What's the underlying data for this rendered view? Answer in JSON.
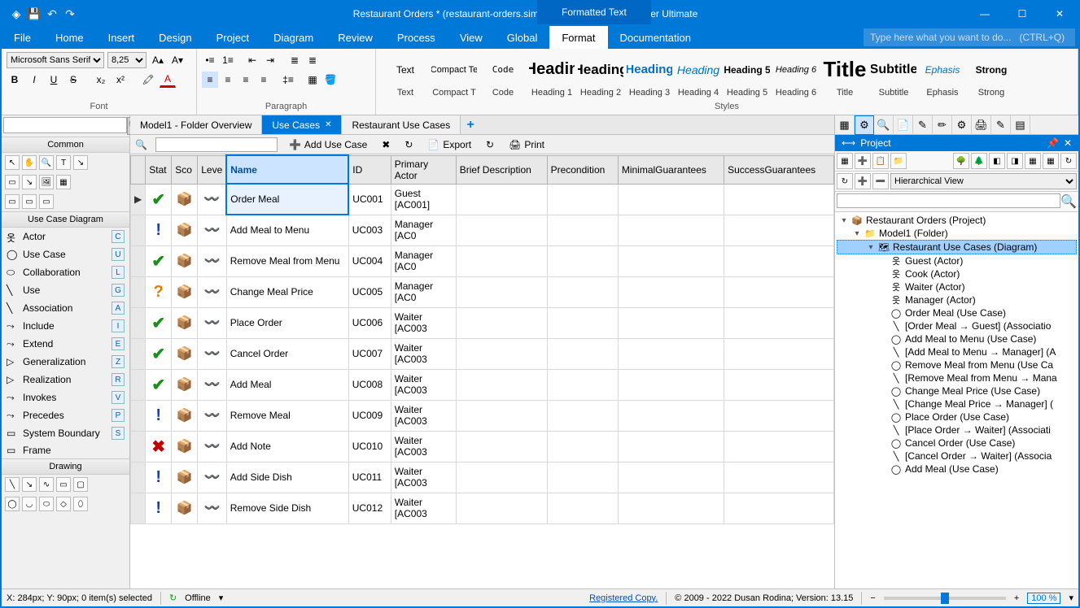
{
  "title": "Restaurant Orders * (restaurant-orders.simp)  - Software Ideas Modeler Ultimate",
  "formatted_tab": "Formatted Text",
  "menu": [
    "File",
    "Home",
    "Insert",
    "Design",
    "Project",
    "Diagram",
    "Review",
    "Process",
    "View",
    "Global",
    "Format",
    "Documentation"
  ],
  "menu_active": "Format",
  "search_placeholder": "Type here what you want to do...   (CTRL+Q)",
  "ribbon": {
    "font_name": "Microsoft Sans Serif",
    "font_size": "8,25",
    "font_label": "Font",
    "para_label": "Paragraph",
    "styles_label": "Styles",
    "styles": [
      {
        "label": "Text",
        "preview": "Text",
        "css": "font-size:12px;"
      },
      {
        "label": "Compact T",
        "preview": "Compact Te",
        "css": "font-size:11px;"
      },
      {
        "label": "Code",
        "preview": "Code",
        "css": "font-family:monospace;font-size:11px;"
      },
      {
        "label": "Heading 1",
        "preview": "Headin",
        "css": "font-size:20px;font-weight:bold;"
      },
      {
        "label": "Heading 2",
        "preview": "Heading",
        "css": "font-size:17px;font-weight:bold;"
      },
      {
        "label": "Heading 3",
        "preview": "Heading",
        "css": "font-size:15px;font-weight:bold;color:#0070c0;"
      },
      {
        "label": "Heading 4",
        "preview": "Heading",
        "css": "font-size:14px;font-style:italic;color:#0070c0;"
      },
      {
        "label": "Heading 5",
        "preview": "Heading 5",
        "css": "font-size:12px;font-weight:bold;"
      },
      {
        "label": "Heading 6",
        "preview": "Heading 6",
        "css": "font-size:11px;font-style:italic;"
      },
      {
        "label": "Title",
        "preview": "Title",
        "css": "font-size:26px;font-weight:bold;"
      },
      {
        "label": "Subtitle",
        "preview": "Subtitle",
        "css": "font-size:16px;font-weight:bold;"
      },
      {
        "label": "Ephasis",
        "preview": "Ephasis",
        "css": "font-size:12px;font-style:italic;color:#0070c0;"
      },
      {
        "label": "Strong",
        "preview": "Strong",
        "css": "font-size:12px;font-weight:bold;"
      }
    ]
  },
  "doc_tabs": [
    {
      "label": "Model1 - Folder Overview",
      "active": false
    },
    {
      "label": "Use Cases",
      "active": true
    },
    {
      "label": "Restaurant Use Cases",
      "active": false
    }
  ],
  "left": {
    "common": "Common",
    "ucd": "Use Case Diagram",
    "drawing": "Drawing",
    "items": [
      {
        "label": "Actor",
        "key": "C"
      },
      {
        "label": "Use Case",
        "key": "U"
      },
      {
        "label": "Collaboration",
        "key": "L"
      },
      {
        "label": "Use",
        "key": "G"
      },
      {
        "label": "Association",
        "key": "A"
      },
      {
        "label": "Include",
        "key": "I"
      },
      {
        "label": "Extend",
        "key": "E"
      },
      {
        "label": "Generalization",
        "key": "Z"
      },
      {
        "label": "Realization",
        "key": "R"
      },
      {
        "label": "Invokes",
        "key": "V"
      },
      {
        "label": "Precedes",
        "key": "P"
      },
      {
        "label": "System Boundary",
        "key": "S"
      },
      {
        "label": "Frame",
        "key": ""
      }
    ]
  },
  "center_tb": {
    "add": "Add Use Case",
    "export": "Export",
    "print": "Print"
  },
  "grid": {
    "columns": [
      "",
      "Stat",
      "Sco",
      "Leve",
      "Name",
      "ID",
      "Primary Actor",
      "Brief Description",
      "Precondition",
      "MinimalGuarantees",
      "SuccessGuarantees"
    ],
    "rows": [
      {
        "stat": "ok",
        "name": "Order Meal",
        "id": "UC001",
        "actor": "Guest [AC001]",
        "sel": true
      },
      {
        "stat": "ex",
        "name": "Add Meal to Menu",
        "id": "UC003",
        "actor": "Manager [AC0"
      },
      {
        "stat": "ok",
        "name": "Remove Meal from Menu",
        "id": "UC004",
        "actor": "Manager [AC0"
      },
      {
        "stat": "q",
        "name": "Change Meal Price",
        "id": "UC005",
        "actor": "Manager [AC0"
      },
      {
        "stat": "ok",
        "name": "Place Order",
        "id": "UC006",
        "actor": "Waiter [AC003"
      },
      {
        "stat": "ok",
        "name": "Cancel Order",
        "id": "UC007",
        "actor": "Waiter [AC003"
      },
      {
        "stat": "ok",
        "name": "Add Meal",
        "id": "UC008",
        "actor": "Waiter [AC003"
      },
      {
        "stat": "ex",
        "name": "Remove Meal",
        "id": "UC009",
        "actor": "Waiter [AC003"
      },
      {
        "stat": "x",
        "name": "Add Note",
        "id": "UC010",
        "actor": "Waiter [AC003"
      },
      {
        "stat": "ex",
        "name": "Add Side Dish",
        "id": "UC011",
        "actor": "Waiter [AC003"
      },
      {
        "stat": "ex",
        "name": "Remove Side Dish",
        "id": "UC012",
        "actor": "Waiter [AC003"
      }
    ]
  },
  "project": {
    "title": "Project",
    "view": "Hierarchical View",
    "tree": [
      {
        "l": 1,
        "exp": "▾",
        "ico": "proj",
        "label": "Restaurant Orders (Project)"
      },
      {
        "l": 2,
        "exp": "▾",
        "ico": "folder",
        "label": "Model1 (Folder)"
      },
      {
        "l": 3,
        "exp": "▾",
        "ico": "diag",
        "label": "Restaurant Use Cases (Diagram)",
        "sel": true
      },
      {
        "l": 4,
        "exp": "",
        "ico": "actor",
        "label": "Guest (Actor)"
      },
      {
        "l": 4,
        "exp": "",
        "ico": "actor",
        "label": "Cook (Actor)"
      },
      {
        "l": 4,
        "exp": "",
        "ico": "actor",
        "label": "Waiter (Actor)"
      },
      {
        "l": 4,
        "exp": "",
        "ico": "actor",
        "label": "Manager (Actor)"
      },
      {
        "l": 4,
        "exp": "",
        "ico": "uc",
        "label": "Order Meal (Use Case)"
      },
      {
        "l": 4,
        "exp": "",
        "ico": "assoc",
        "label": "[Order Meal → Guest] (Associatio"
      },
      {
        "l": 4,
        "exp": "",
        "ico": "uc",
        "label": "Add Meal to Menu (Use Case)"
      },
      {
        "l": 4,
        "exp": "",
        "ico": "assoc",
        "label": "[Add Meal to Menu → Manager] (A"
      },
      {
        "l": 4,
        "exp": "",
        "ico": "uc",
        "label": "Remove Meal from Menu (Use Ca"
      },
      {
        "l": 4,
        "exp": "",
        "ico": "assoc",
        "label": "[Remove Meal from Menu → Mana"
      },
      {
        "l": 4,
        "exp": "",
        "ico": "uc",
        "label": "Change Meal Price (Use Case)"
      },
      {
        "l": 4,
        "exp": "",
        "ico": "assoc",
        "label": "[Change Meal Price → Manager] ("
      },
      {
        "l": 4,
        "exp": "",
        "ico": "uc",
        "label": "Place Order (Use Case)"
      },
      {
        "l": 4,
        "exp": "",
        "ico": "assoc",
        "label": "[Place Order → Waiter] (Associati"
      },
      {
        "l": 4,
        "exp": "",
        "ico": "uc",
        "label": "Cancel Order (Use Case)"
      },
      {
        "l": 4,
        "exp": "",
        "ico": "assoc",
        "label": "[Cancel Order → Waiter] (Associa"
      },
      {
        "l": 4,
        "exp": "",
        "ico": "uc",
        "label": "Add Meal (Use Case)"
      }
    ]
  },
  "status": {
    "coords": "X: 284px; Y: 90px; 0 item(s) selected",
    "offline": "Offline",
    "registered": "Registered Copy.",
    "copyright": "© 2009 - 2022 Dusan Rodina; Version: 13.15",
    "zoom": "100 %"
  }
}
